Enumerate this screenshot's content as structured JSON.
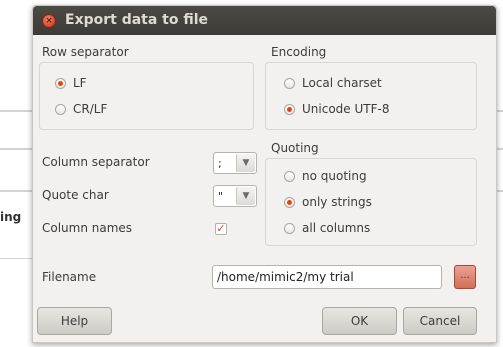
{
  "background": {
    "partial_text": "ing"
  },
  "dialog": {
    "title": "Export data to file",
    "row_separator": {
      "heading": "Row separator",
      "options": [
        {
          "label": "LF",
          "selected": true
        },
        {
          "label": "CR/LF",
          "selected": false
        }
      ]
    },
    "encoding": {
      "heading": "Encoding",
      "options": [
        {
          "label": "Local charset",
          "selected": false
        },
        {
          "label": "Unicode UTF-8",
          "selected": true
        }
      ]
    },
    "column_separator": {
      "label": "Column separator",
      "value": ";"
    },
    "quote_char": {
      "label": "Quote char",
      "value": "\""
    },
    "column_names": {
      "label": "Column names",
      "checked": true
    },
    "quoting": {
      "heading": "Quoting",
      "options": [
        {
          "label": "no quoting",
          "selected": false
        },
        {
          "label": "only strings",
          "selected": true
        },
        {
          "label": "all columns",
          "selected": false
        }
      ]
    },
    "filename": {
      "label": "Filename",
      "value": "/home/mimic2/my trial",
      "browse_label": "..."
    },
    "buttons": {
      "help": "Help",
      "ok": "OK",
      "cancel": "Cancel"
    }
  },
  "colors": {
    "accent": "#dd4814",
    "titlebar": "#3c3b37",
    "dialog_bg": "#f2f1f0"
  },
  "icons": {
    "close": "close-icon",
    "dropdown": "chevron-down-icon",
    "check": "check-icon"
  }
}
